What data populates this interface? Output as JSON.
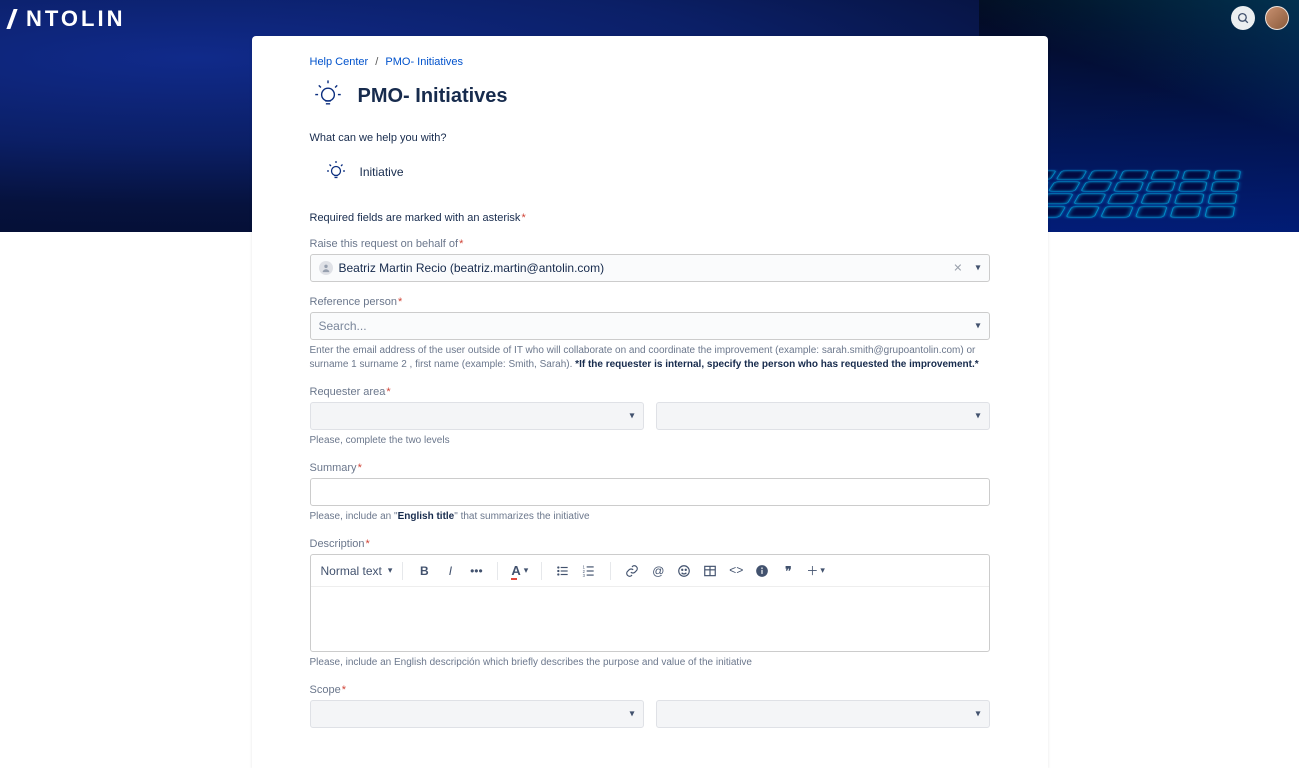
{
  "brand": "NTOLIN",
  "breadcrumb": {
    "home": "Help Center",
    "current": "PMO- Initiatives"
  },
  "page_title": "PMO- Initiatives",
  "help_prompt": "What can we help you with?",
  "request_type": "Initiative",
  "required_note": "Required fields are marked with an asterisk",
  "fields": {
    "raise": {
      "label": "Raise this request on behalf of",
      "value": "Beatriz Martin Recio (beatriz.martin@antolin.com)"
    },
    "reference": {
      "label": "Reference person",
      "placeholder": "Search...",
      "helper_pre": "Enter the email address of the user outside of IT who will collaborate on and coordinate the improvement (example: sarah.smith@grupoantolin.com) or surname 1 surname 2 , first name (example: Smith, Sarah). ",
      "helper_bold": "*If the requester is internal, specify the person who has requested the improvement.*"
    },
    "requester_area": {
      "label": "Requester area",
      "helper": "Please, complete the two levels"
    },
    "summary": {
      "label": "Summary",
      "helper_pre": "Please, include an \"",
      "helper_bold": "English title",
      "helper_post": "\" that summarizes the initiative"
    },
    "description": {
      "label": "Description",
      "text_style": "Normal text",
      "helper": "Please, include an English descripción which briefly describes the purpose and value of the initiative"
    },
    "scope": {
      "label": "Scope"
    }
  }
}
